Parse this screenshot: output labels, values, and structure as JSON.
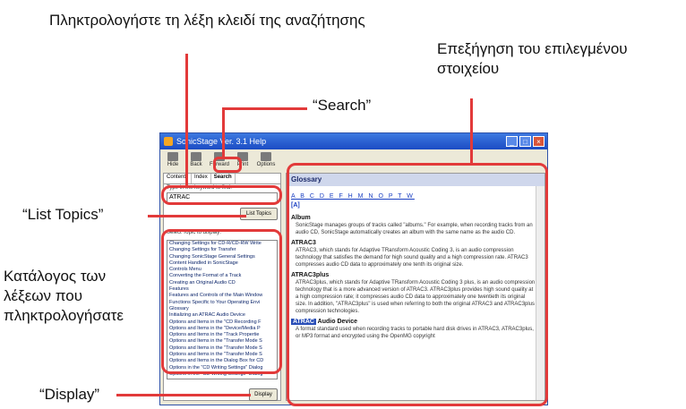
{
  "annotations": {
    "keyword": "Πληκτρολογήστε τη λέξη κλειδί της αναζήτησης",
    "explanation": "Επεξήγηση του επιλεγμένου στοιχείου",
    "search": "“Search”",
    "list_topics": "“List Topics”",
    "catalog": "Κατάλογος των λέξεων που πληκτρολογήσατε",
    "display": "“Display”"
  },
  "window": {
    "title": "SonicStage Ver. 3.1 Help",
    "toolbar": [
      {
        "icon": "hide-icon",
        "label": "Hide"
      },
      {
        "icon": "back-icon",
        "label": "Back"
      },
      {
        "icon": "forward-icon",
        "label": "Forward"
      },
      {
        "icon": "print-icon",
        "label": "Print"
      },
      {
        "icon": "options-icon",
        "label": "Options"
      }
    ],
    "tabs": [
      "Contents",
      "Index",
      "Search"
    ],
    "keyword_prompt": "Type in the keyword to find:",
    "keyword_value": "ATRAC",
    "list_topics_button": "List Topics",
    "select_topic_label": "Select Topic to display:",
    "topics": [
      "Changing Settings for CD-R/CD-RW Write",
      "Changing Settings for Transfer",
      "Changing SonicStage General Settings",
      "Content Handled in SonicStage",
      "Controls Menu",
      "Converting the Format of a Track",
      "Creating an Original Audio CD",
      "Features",
      "Features and Controls of the Main Window",
      "Functions Specific to Your Operating Envi",
      "Glossary",
      "Initializing an ATRAC Audio Device",
      "Options and Items in the \"CD Recording F",
      "Options and Items in the \"Device/Media P",
      "Options and Items in the \"Track Propertie",
      "Options and Items in the \"Transfer Mode S",
      "Options and Items in the \"Transfer Mode S",
      "Options and Items in the \"Transfer Mode S",
      "Options and Items in the Dialog Box for CD",
      "Options in the \"CD Writing Settings\" Dialog",
      "Options in the \"CD Writing Settings\" Dialog"
    ],
    "display_button": "Display",
    "glossary_title": "Glossary",
    "letters": "A B C D E F H M N O P T W",
    "hash": "[A]",
    "entries": [
      {
        "title": "Album",
        "body": "SonicStage manages groups of tracks called \"albums.\" For example, when recording tracks from an audio CD, SonicStage automatically creates an album with the same name as the audio CD."
      },
      {
        "title": "ATRAC3",
        "body": "ATRAC3, which stands for Adaptive TRansform Acoustic Coding 3, is an audio compression technology that satisfies the demand for high sound quality and a high compression rate. ATRAC3 compresses audio CD data to approximately one tenth its original size."
      },
      {
        "title": "ATRAC3plus",
        "body": "ATRAC3plus, which stands for Adaptive TRansform Acoustic Coding 3 plus, is an audio compression technology that is a more advanced version of ATRAC3. ATRAC3plus provides high sound quality at a high compression rate; it compresses audio CD data to approximately one twentieth its original size. In addition, \"ATRAC3plus\" is used when referring to both the original ATRAC3 and ATRAC3plus compression technologies."
      },
      {
        "title_hl": "ATRAC",
        "title_rest": " Audio Device",
        "body": "A format standard used when recording tracks to portable hard disk drives in ATRAC3, ATRAC3plus, or MP3 format and encrypted using the OpenMG copyright"
      }
    ]
  }
}
